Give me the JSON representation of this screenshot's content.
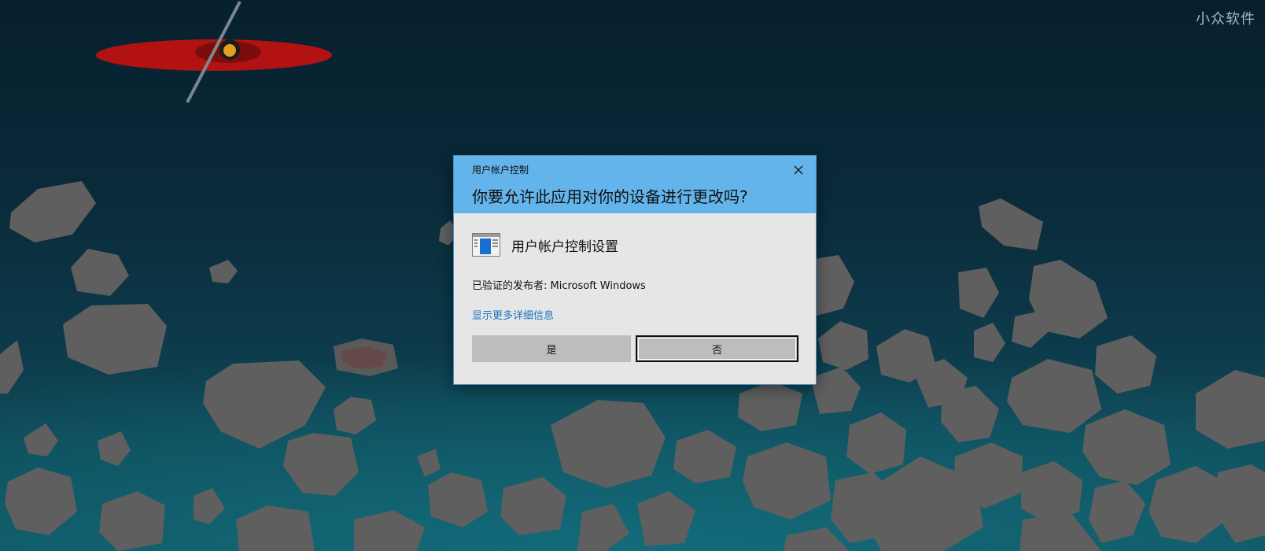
{
  "desktop": {
    "watermark": "小众软件"
  },
  "dialog": {
    "caption": "用户帐户控制",
    "question": "你要允许此应用对你的设备进行更改吗?",
    "close_icon": "close-icon",
    "app_name": "用户帐户控制设置",
    "app_icon": "settings-window-icon",
    "publisher_label": "已验证的发布者: Microsoft Windows",
    "more_details_link": "显示更多详细信息",
    "yes_label": "是",
    "no_label": "否",
    "colors": {
      "header": "#63b4ea",
      "body": "#e6e6e6",
      "button": "#bdbdbd",
      "link": "#1a73c2"
    }
  }
}
